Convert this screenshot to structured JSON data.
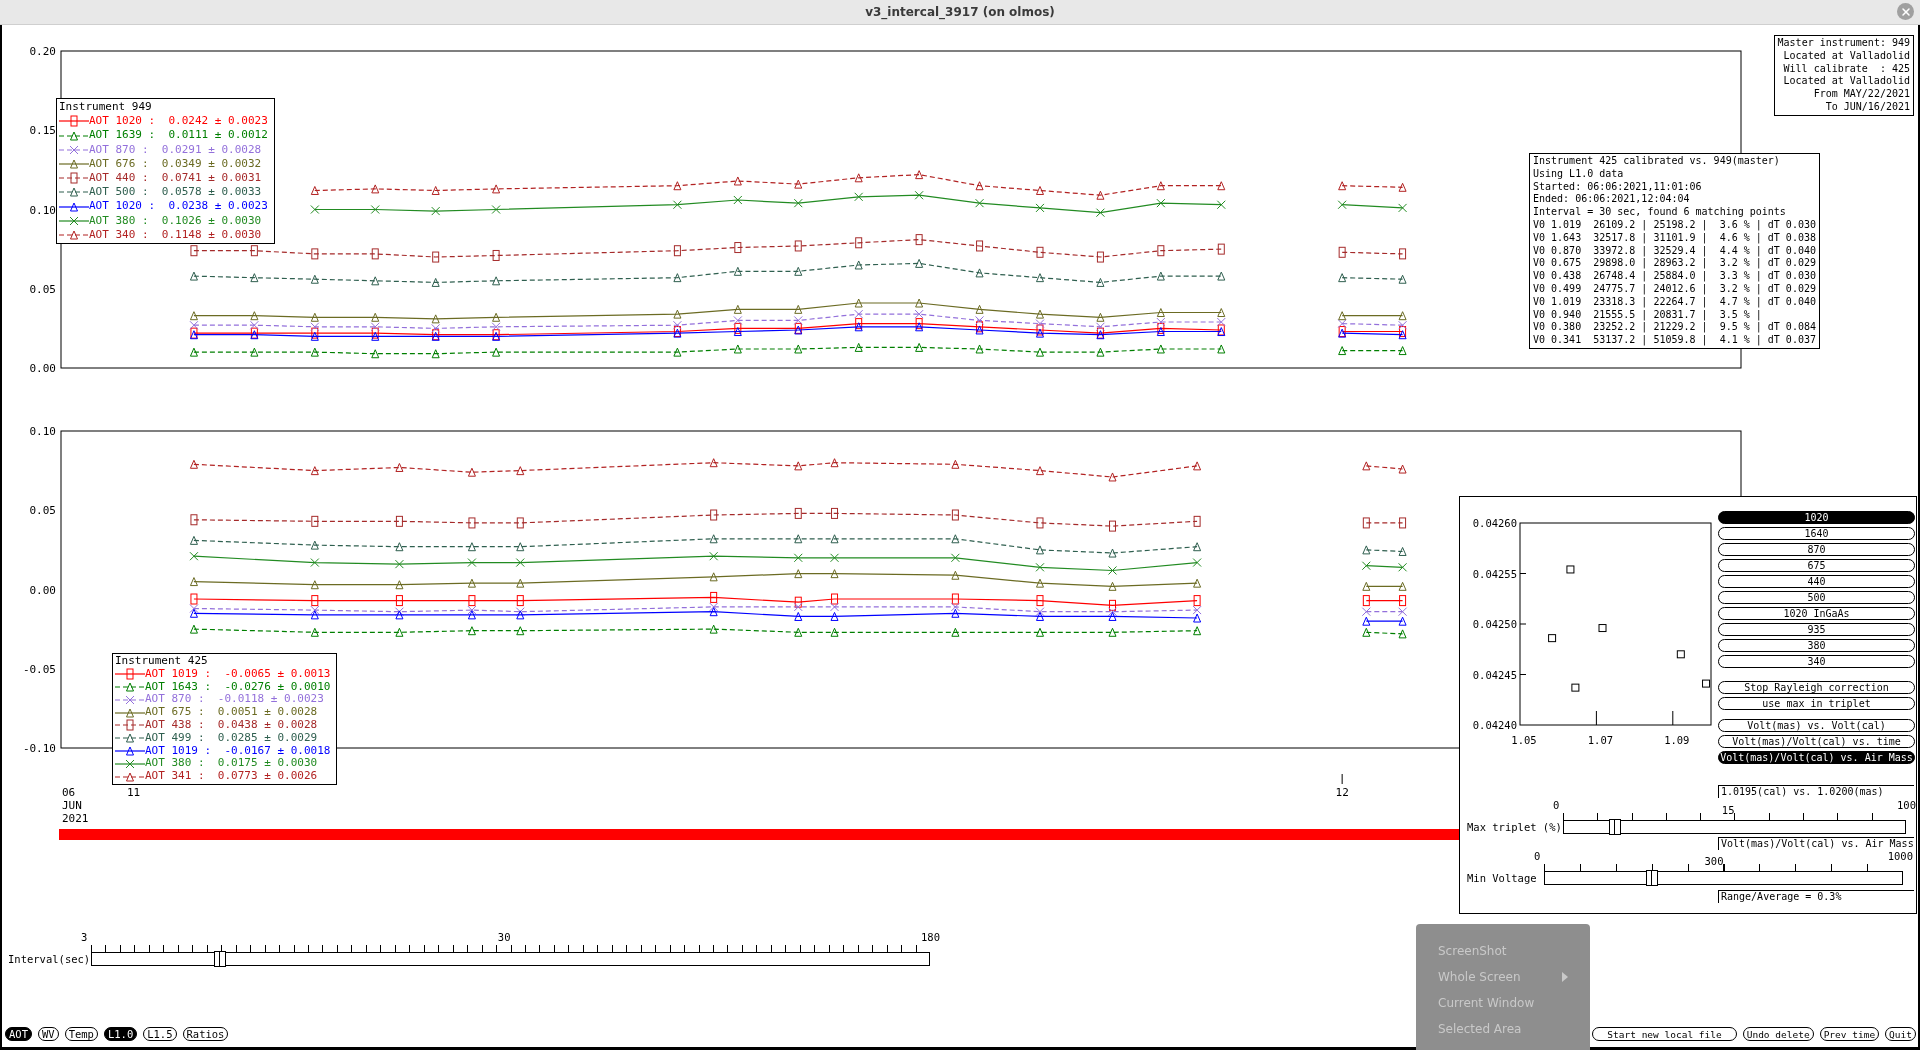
{
  "window": {
    "title": "v3_intercal_3917 (on olmos)"
  },
  "master_info": [
    "Master instrument: 949",
    "Located at Valladolid",
    "Will calibrate  : 425",
    "Located at Valladolid",
    "From MAY/22/2021",
    "To JUN/16/2021"
  ],
  "calibration_info": [
    "Instrument 425 calibrated vs. 949(master)",
    "Using L1.0 data",
    "Started: 06:06:2021,11:01:06",
    "Ended: 06:06:2021,12:04:04",
    "Interval = 30 sec, found 6 matching points",
    "V0 1.019  26109.2 | 25198.2 |  3.6 % | dT 0.030",
    "V0 1.643  32517.8 | 31101.9 |  4.6 % | dT 0.038",
    "V0 0.870  33972.8 | 32529.4 |  4.4 % | dT 0.040",
    "V0 0.675  29898.0 | 28963.2 |  3.2 % | dT 0.029",
    "V0 0.438  26748.4 | 25884.0 |  3.3 % | dT 0.030",
    "V0 0.499  24775.7 | 24012.6 |  3.2 % | dT 0.029",
    "V0 1.019  23318.3 | 22264.7 |  4.7 % | dT 0.040",
    "V0 0.940  21555.5 | 20831.7 |  3.5 % |",
    "V0 0.380  23252.2 | 21229.2 |  9.5 % | dT 0.084",
    "V0 0.341  53137.2 | 51059.8 |  4.1 % | dT 0.037"
  ],
  "master_plot": {
    "legend": {
      "title": "Instrument 949",
      "entries": [
        {
          "text": ":  0.0242 ± 0.0023"
        },
        {
          "text": ":  0.0111 ± 0.0012"
        },
        {
          "text": ":  0.0291 ± 0.0028"
        },
        {
          "text": ":  0.0349 ± 0.0032"
        },
        {
          "text": ":  0.0741 ± 0.0031"
        },
        {
          "text": ":  0.0578 ± 0.0033"
        },
        {
          "text": ":  0.0238 ± 0.0023"
        },
        {
          "text": ":  0.1026 ± 0.0030"
        },
        {
          "text": ":  0.1148 ± 0.0030"
        }
      ]
    },
    "chart_data": {
      "type": "line",
      "xlim": [
        10.94,
        12.33
      ],
      "ylim": [
        0,
        0.2
      ],
      "yticks": [
        {
          "value": 0,
          "label": "0.00"
        },
        {
          "value": 0.05,
          "label": "0.05"
        },
        {
          "value": 0.1,
          "label": "0.10"
        },
        {
          "value": 0.15,
          "label": "0.15"
        },
        {
          "value": 0.2,
          "label": "0.20"
        }
      ],
      "x": [
        11.05,
        11.1,
        11.15,
        11.2,
        11.25,
        11.3,
        11.45,
        11.5,
        11.55,
        11.6,
        11.65,
        11.7,
        11.75,
        11.8,
        11.85,
        11.9,
        11.95,
        12.0,
        12.05
      ],
      "series": [
        {
          "name": "AOT 1020",
          "color": "#ff0000",
          "marker": "square",
          "line_style": "solid",
          "values": [
            0.022,
            0.022,
            0.022,
            0.022,
            0.021,
            0.021,
            0.023,
            0.025,
            0.025,
            0.028,
            0.028,
            0.026,
            0.024,
            0.022,
            0.025,
            0.024,
            null,
            0.023,
            0.023
          ]
        },
        {
          "name": "AOT 1639",
          "color": "#007f00",
          "marker": "triangle",
          "line_style": "dashed",
          "values": [
            0.01,
            0.01,
            0.01,
            0.009,
            0.009,
            0.01,
            0.01,
            0.012,
            0.012,
            0.013,
            0.013,
            0.012,
            0.01,
            0.01,
            0.012,
            0.012,
            null,
            0.011,
            0.011
          ]
        },
        {
          "name": "AOT 870",
          "color": "#9370db",
          "marker": "cross",
          "line_style": "dashed",
          "values": [
            0.027,
            0.027,
            0.026,
            0.026,
            0.025,
            0.026,
            0.027,
            0.03,
            0.03,
            0.034,
            0.034,
            0.03,
            0.028,
            0.026,
            0.029,
            0.029,
            null,
            0.028,
            0.027
          ]
        },
        {
          "name": "AOT 676",
          "color": "#6b6b23",
          "marker": "triangle",
          "line_style": "solid",
          "values": [
            0.033,
            0.033,
            0.032,
            0.032,
            0.031,
            0.032,
            0.034,
            0.037,
            0.037,
            0.041,
            0.041,
            0.037,
            0.034,
            0.032,
            0.035,
            0.035,
            null,
            0.033,
            0.033
          ]
        },
        {
          "name": "AOT 440",
          "color": "#a52a2a",
          "marker": "square",
          "line_style": "dashed",
          "values": [
            0.074,
            0.074,
            0.072,
            0.072,
            0.07,
            0.071,
            0.074,
            0.076,
            0.077,
            0.079,
            0.081,
            0.077,
            0.073,
            0.07,
            0.074,
            0.075,
            null,
            0.073,
            0.072
          ]
        },
        {
          "name": "AOT 500",
          "color": "#2f5f4f",
          "marker": "triangle",
          "line_style": "dashed",
          "values": [
            0.058,
            0.057,
            0.056,
            0.055,
            0.054,
            0.055,
            0.057,
            0.061,
            0.061,
            0.065,
            0.066,
            0.06,
            0.057,
            0.054,
            0.058,
            0.058,
            null,
            0.057,
            0.056
          ]
        },
        {
          "name": "AOT 1020",
          "color": "#0000ff",
          "marker": "triangle",
          "line_style": "solid",
          "values": [
            0.021,
            0.021,
            0.02,
            0.02,
            0.02,
            0.02,
            0.022,
            0.023,
            0.024,
            0.026,
            0.026,
            0.024,
            0.022,
            0.021,
            0.023,
            0.023,
            null,
            0.022,
            0.021
          ]
        },
        {
          "name": "AOT 380",
          "color": "#228b22",
          "marker": "cross",
          "line_style": "solid",
          "values": [
            null,
            null,
            0.1,
            0.1,
            0.099,
            0.1,
            0.103,
            0.106,
            0.104,
            0.108,
            0.109,
            0.104,
            0.101,
            0.098,
            0.104,
            0.103,
            null,
            0.103,
            0.101
          ]
        },
        {
          "name": "AOT 340",
          "color": "#b22222",
          "marker": "triangle",
          "line_style": "dashed",
          "values": [
            null,
            null,
            0.112,
            0.113,
            0.112,
            0.113,
            0.115,
            0.118,
            0.116,
            0.12,
            0.122,
            0.115,
            0.112,
            0.109,
            0.115,
            0.115,
            null,
            0.115,
            0.114
          ]
        }
      ]
    }
  },
  "calibrated_plot": {
    "legend": {
      "title": "Instrument 425",
      "entries": [
        {
          "text": ":  -0.0065 ± 0.0013"
        },
        {
          "text": ":  -0.0276 ± 0.0010"
        },
        {
          "text": ":  -0.0118 ± 0.0023"
        },
        {
          "text": ":  0.0051 ± 0.0028"
        },
        {
          "text": ":  0.0438 ± 0.0028"
        },
        {
          "text": ":  0.0285 ± 0.0029"
        },
        {
          "text": ":  -0.0167 ± 0.0018"
        },
        {
          "text": ":  0.0175 ± 0.0030"
        },
        {
          "text": ":  0.0773 ± 0.0026"
        }
      ]
    },
    "date_label": [
      "06",
      "JUN",
      "2021"
    ],
    "chart_data": {
      "type": "line",
      "xlim": [
        10.94,
        12.33
      ],
      "ylim": [
        -0.1,
        0.1
      ],
      "xticks": [
        {
          "value": 11,
          "label": "11"
        },
        {
          "value": 12,
          "label": "12"
        }
      ],
      "yticks": [
        {
          "value": -0.1,
          "label": "-0.10"
        },
        {
          "value": -0.05,
          "label": "-0.05"
        },
        {
          "value": 0,
          "label": "0.00"
        },
        {
          "value": 0.05,
          "label": "0.05"
        },
        {
          "value": 0.1,
          "label": "0.10"
        }
      ],
      "x": [
        11.05,
        11.15,
        11.22,
        11.28,
        11.32,
        11.48,
        11.55,
        11.58,
        11.68,
        11.75,
        11.81,
        11.88,
        11.95,
        12.02,
        12.05
      ],
      "series": [
        {
          "name": "AOT 1019",
          "color": "#ff0000",
          "marker": "square",
          "line_style": "solid",
          "values": [
            -0.006,
            -0.007,
            -0.007,
            -0.007,
            -0.007,
            -0.005,
            -0.008,
            -0.006,
            -0.006,
            -0.007,
            -0.01,
            -0.007,
            null,
            -0.007,
            -0.007
          ]
        },
        {
          "name": "AOT 1643",
          "color": "#007f00",
          "marker": "triangle",
          "line_style": "dashed",
          "values": [
            -0.025,
            -0.027,
            -0.027,
            -0.026,
            -0.026,
            -0.025,
            -0.027,
            -0.027,
            -0.027,
            -0.027,
            -0.027,
            -0.026,
            null,
            -0.027,
            -0.028
          ]
        },
        {
          "name": "AOT 870",
          "color": "#9370db",
          "marker": "cross",
          "line_style": "dashed",
          "values": [
            -0.012,
            -0.013,
            -0.014,
            -0.013,
            -0.014,
            -0.011,
            -0.011,
            -0.011,
            -0.011,
            -0.014,
            -0.014,
            -0.013,
            null,
            -0.014,
            -0.014
          ]
        },
        {
          "name": "AOT 675",
          "color": "#6b6b23",
          "marker": "triangle",
          "line_style": "solid",
          "values": [
            0.005,
            0.003,
            0.003,
            0.004,
            0.004,
            0.008,
            0.01,
            0.01,
            0.009,
            0.004,
            0.002,
            0.004,
            null,
            0.002,
            0.002
          ]
        },
        {
          "name": "AOT 438",
          "color": "#a52a2a",
          "marker": "square",
          "line_style": "dashed",
          "values": [
            0.044,
            0.043,
            0.043,
            0.042,
            0.042,
            0.047,
            0.048,
            0.048,
            0.047,
            0.042,
            0.04,
            0.043,
            null,
            0.042,
            0.042
          ]
        },
        {
          "name": "AOT 499",
          "color": "#2f5f4f",
          "marker": "triangle",
          "line_style": "dashed",
          "values": [
            0.031,
            0.028,
            0.027,
            0.027,
            0.027,
            0.032,
            0.032,
            0.032,
            0.032,
            0.025,
            0.023,
            0.027,
            null,
            0.025,
            0.024
          ]
        },
        {
          "name": "AOT 1019",
          "color": "#0000ff",
          "marker": "triangle",
          "line_style": "solid",
          "values": [
            -0.015,
            -0.016,
            -0.016,
            -0.016,
            -0.016,
            -0.014,
            -0.017,
            -0.017,
            -0.015,
            -0.017,
            -0.017,
            -0.018,
            null,
            -0.02,
            -0.02
          ]
        },
        {
          "name": "AOT 380",
          "color": "#228b22",
          "marker": "cross",
          "line_style": "solid",
          "values": [
            0.021,
            0.017,
            0.016,
            0.017,
            0.017,
            0.021,
            0.02,
            0.02,
            0.02,
            0.014,
            0.012,
            0.017,
            null,
            0.015,
            0.014
          ]
        },
        {
          "name": "AOT 341",
          "color": "#b22222",
          "marker": "triangle",
          "line_style": "dashed",
          "values": [
            0.079,
            0.075,
            0.077,
            0.074,
            0.075,
            0.08,
            0.078,
            0.08,
            0.079,
            0.075,
            0.071,
            0.078,
            null,
            0.078,
            0.076
          ]
        }
      ]
    }
  },
  "calibration_panel": {
    "chart_data": {
      "type": "scatter",
      "xlim": [
        1.05,
        1.1
      ],
      "ylim": [
        0.0424,
        0.0426
      ],
      "xticks": [
        {
          "value": 1.05,
          "label": "1.05"
        },
        {
          "value": 1.07,
          "label": "1.07"
        },
        {
          "value": 1.09,
          "label": "1.09"
        }
      ],
      "yticks": [
        {
          "value": 0.0424,
          "label": "0.04240"
        },
        {
          "value": 0.04245,
          "label": "0.04245"
        },
        {
          "value": 0.0425,
          "label": "0.04250"
        },
        {
          "value": 0.04255,
          "label": "0.04255"
        },
        {
          "value": 0.0426,
          "label": "0.04260"
        }
      ],
      "x": [
        1.0584,
        1.0632,
        1.0645,
        1.0716,
        1.0921,
        1.0987
      ],
      "series": [
        {
          "color": "#000000",
          "marker": "square",
          "values": [
            0.042486,
            0.042554,
            0.042437,
            0.042496,
            0.04247,
            0.042441
          ]
        }
      ]
    },
    "wavelength_buttons": [
      {
        "label": "1020",
        "selected": true
      },
      {
        "label": "1640",
        "selected": false
      },
      {
        "label": "870",
        "selected": false
      },
      {
        "label": "675",
        "selected": false
      },
      {
        "label": "440",
        "selected": false
      },
      {
        "label": "500",
        "selected": false
      },
      {
        "label": "1020 InGaAs",
        "selected": false
      },
      {
        "label": "935",
        "selected": false
      },
      {
        "label": "380",
        "selected": false
      },
      {
        "label": "340",
        "selected": false
      }
    ],
    "options": [
      {
        "label": "Stop Rayleigh correction",
        "selected": false
      },
      {
        "label": "use max in triplet",
        "selected": false
      }
    ],
    "plot_modes": [
      {
        "label": "Volt(mas) vs. Volt(cal)",
        "selected": false
      },
      {
        "label": "Volt(mas)/Volt(cal) vs. time",
        "selected": false
      },
      {
        "label": "Volt(mas)/Volt(cal) vs. Air Mass",
        "selected": true
      }
    ],
    "wavelength_note": "1.0195(cal) vs. 1.0200(mas)",
    "triplet_slider": {
      "label": "Max triplet (%)",
      "min_label": "0",
      "value_label": "15",
      "max_label": "100",
      "level": 0.15
    },
    "mode_note": "Volt(mas)/Volt(cal) vs. Air Mass",
    "voltage_slider": {
      "label": "Min Voltage",
      "min_label": "0",
      "value_label": "300",
      "max_label": "1000",
      "level": 0.3
    },
    "range_note": "Range/Average = 0.3%"
  },
  "interval_slider": {
    "label": "Interval(sec)",
    "min_label": "3",
    "value_label": "30",
    "max_label": "180",
    "level": 0.153
  },
  "data_buttons": [
    {
      "label": "AOT",
      "selected": true
    },
    {
      "label": "WV",
      "selected": false
    },
    {
      "label": "Temp",
      "selected": false
    },
    {
      "label": "L1.0",
      "selected": true
    },
    {
      "label": "L1.5",
      "selected": false
    },
    {
      "label": "Ratios",
      "selected": false
    }
  ],
  "action_buttons": [
    "Start new local file",
    "Undo delete",
    "Prev time",
    "Quit"
  ],
  "context_menu": {
    "title": "ScreenShot",
    "items": [
      {
        "label": "Whole Screen",
        "submenu": true
      },
      {
        "label": "Current Window",
        "submenu": false
      },
      {
        "label": "Selected Area",
        "submenu": false
      }
    ]
  }
}
